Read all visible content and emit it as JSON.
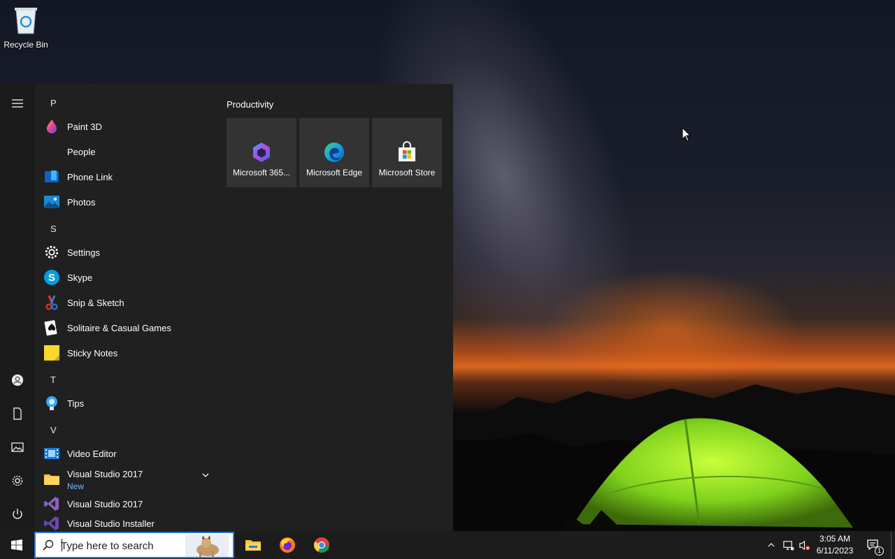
{
  "desktop": {
    "recycle_bin_label": "Recycle Bin"
  },
  "start_menu": {
    "hamburger_icon": "hamburger-icon",
    "rail_icons": [
      "user-icon",
      "document-icon",
      "pictures-icon",
      "settings-icon",
      "power-icon"
    ],
    "app_list": {
      "letter_p": "P",
      "paint3d": "Paint 3D",
      "people": "People",
      "phone_link": "Phone Link",
      "photos": "Photos",
      "letter_s": "S",
      "settings": "Settings",
      "skype": "Skype",
      "snip": "Snip & Sketch",
      "solitaire": "Solitaire & Casual Games",
      "sticky": "Sticky Notes",
      "letter_t": "T",
      "tips": "Tips",
      "letter_v": "V",
      "video_editor": "Video Editor",
      "vs2017_folder": "Visual Studio 2017",
      "vs2017_folder_badge": "New",
      "vs2017": "Visual Studio 2017",
      "vs_installer": "Visual Studio Installer"
    },
    "tiles": {
      "group_title": "Productivity",
      "m365": "Microsoft 365...",
      "edge": "Microsoft Edge",
      "store": "Microsoft Store"
    }
  },
  "taskbar": {
    "search_placeholder": "Type here to search",
    "apps": [
      "file-explorer-icon",
      "firefox-icon",
      "chrome-icon"
    ],
    "time": "3:05 AM",
    "date": "6/11/2023",
    "notification_count": "1"
  },
  "colors": {
    "start_bg": "#202020",
    "tile_bg": "#333333",
    "accent": "#2a7ad8",
    "new_badge": "#7fb6ff"
  }
}
